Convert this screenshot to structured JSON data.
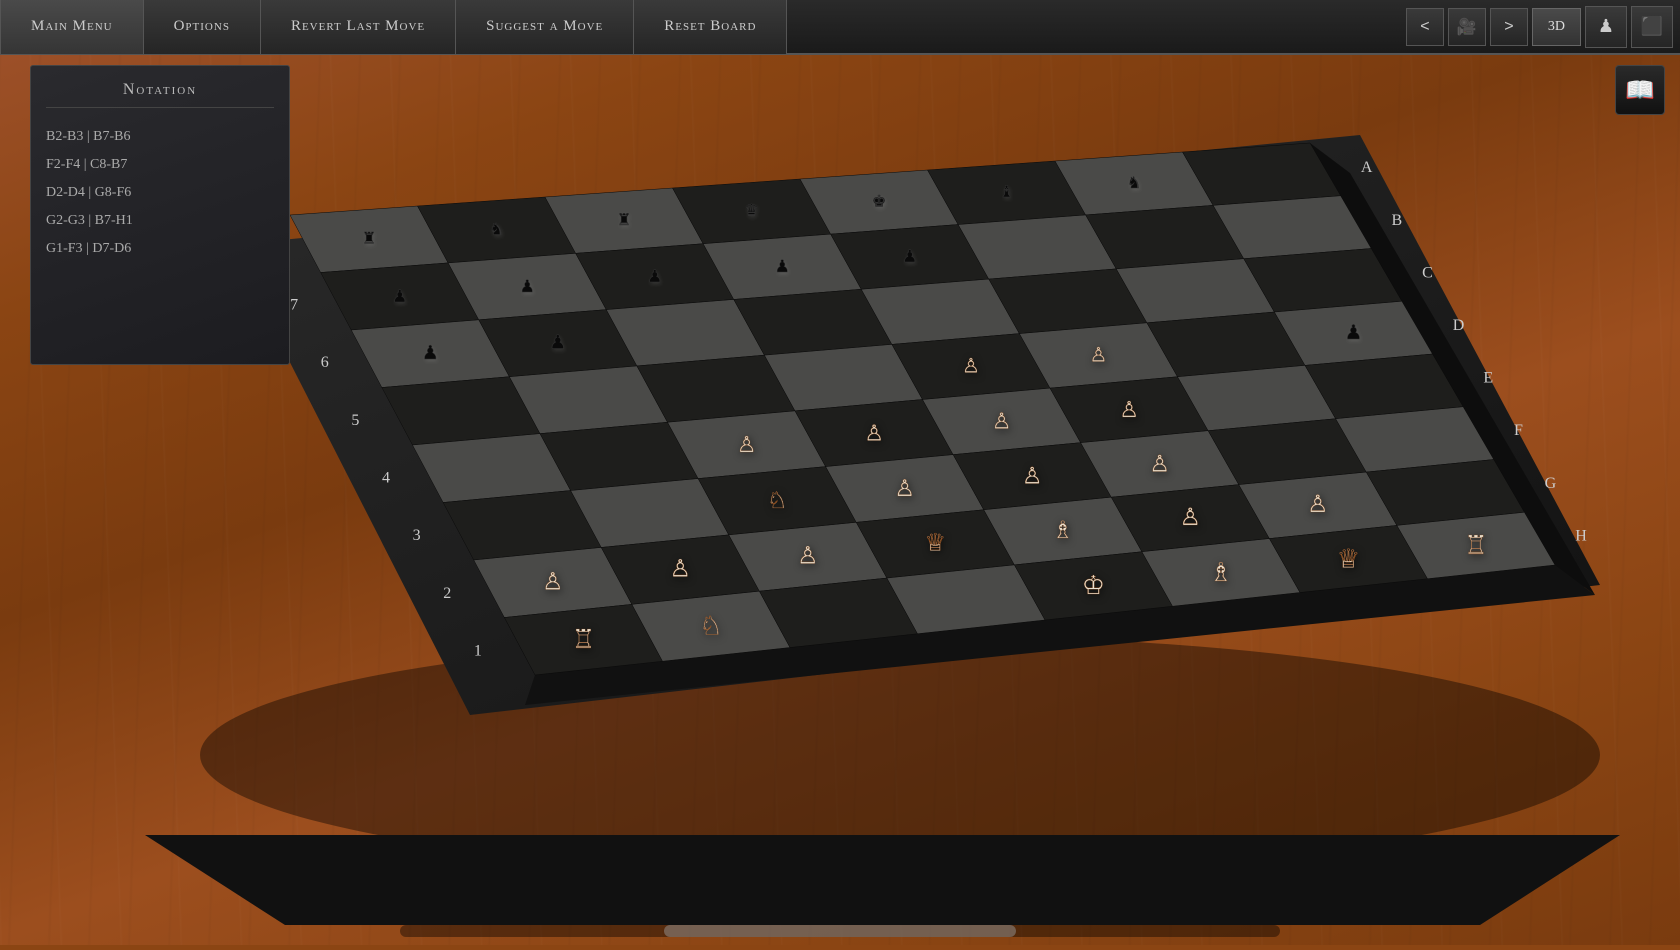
{
  "menuBar": {
    "buttons": [
      {
        "id": "main-menu",
        "label": "Main Menu"
      },
      {
        "id": "options",
        "label": "Options"
      },
      {
        "id": "revert-last-move",
        "label": "Revert Last Move"
      },
      {
        "id": "suggest-move",
        "label": "Suggest a Move"
      },
      {
        "id": "reset-board",
        "label": "Reset Board"
      }
    ],
    "nav": {
      "prev": "<",
      "camera": "📷",
      "next": ">",
      "view3d": "3D",
      "playerIcon": "♟",
      "boardIcon": "⬛"
    }
  },
  "notationPanel": {
    "title": "Notation",
    "moves": [
      "B2-B3 | B7-B6",
      "F2-F4 | C8-B7",
      "D2-D4 | G8-F6",
      "G2-G3 | B7-H1",
      "G1-F3 | D7-D6"
    ]
  },
  "board": {
    "colLabels": [
      "H",
      "G",
      "F",
      "E",
      "D",
      "C",
      "B"
    ],
    "rowLabels": [
      "2",
      "3",
      "4",
      "5",
      "6"
    ],
    "pieces": {
      "black": {
        "description": "Black pieces (top of board, dark colored)"
      },
      "white": {
        "description": "White pieces (bottom of board, cream/ivory colored with rust accents)"
      }
    }
  },
  "bookIcon": "📖",
  "scrollbar": {
    "thumbPosition": "30%",
    "thumbWidth": "40%"
  }
}
